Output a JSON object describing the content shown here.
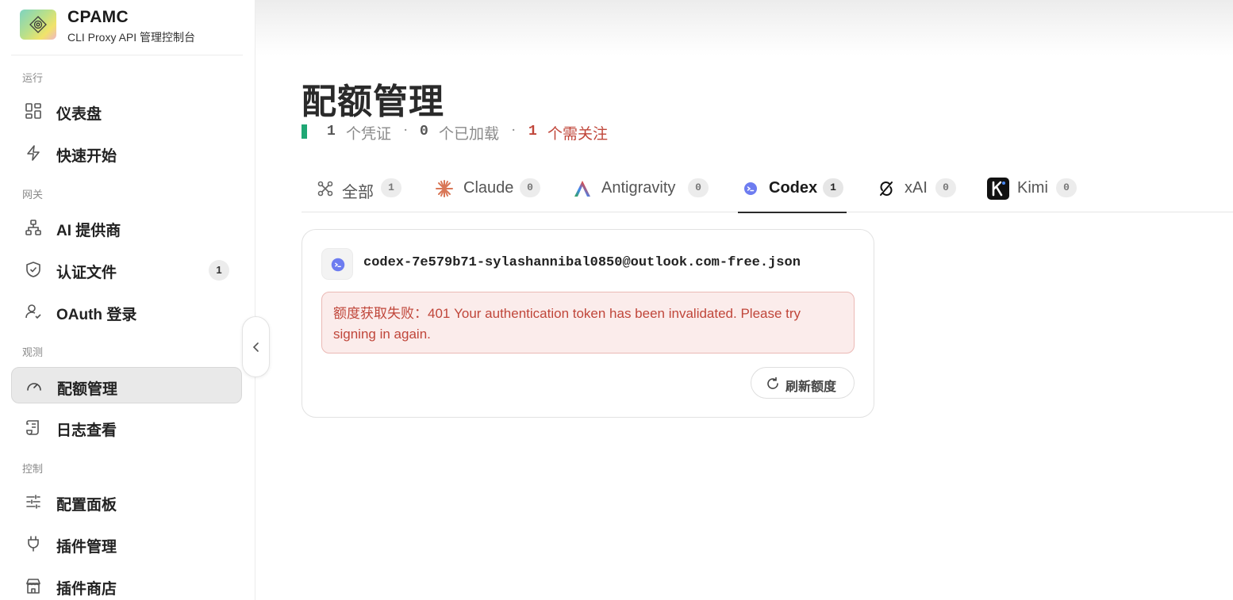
{
  "brand": {
    "name": "CPAMC",
    "subtitle": "CLI Proxy API 管理控制台"
  },
  "sidebar": {
    "sections": [
      "运行",
      "网关",
      "观测",
      "控制"
    ],
    "items": [
      {
        "label": "仪表盘",
        "icon": "dashboard-icon"
      },
      {
        "label": "快速开始",
        "icon": "lightning-icon"
      },
      {
        "label": "AI 提供商",
        "icon": "network-icon"
      },
      {
        "label": "认证文件",
        "icon": "shield-icon",
        "badge": "1"
      },
      {
        "label": "OAuth 登录",
        "icon": "user-icon"
      },
      {
        "label": "配额管理",
        "icon": "gauge-icon",
        "active": true
      },
      {
        "label": "日志查看",
        "icon": "scroll-icon"
      },
      {
        "label": "配置面板",
        "icon": "sliders-icon"
      },
      {
        "label": "插件管理",
        "icon": "plug-icon"
      },
      {
        "label": "插件商店",
        "icon": "store-icon"
      }
    ]
  },
  "page": {
    "title": "配额管理",
    "stats": {
      "credentials_count": "1",
      "credentials_label": "个凭证",
      "loaded_count": "0",
      "loaded_label": "个已加载",
      "attention_count": "1",
      "attention_label": "个需关注",
      "separator": "·"
    }
  },
  "tabs": [
    {
      "label": "全部",
      "count": "1",
      "icon": "all-icon"
    },
    {
      "label": "Claude",
      "count": "0",
      "icon": "claude-icon"
    },
    {
      "label": "Antigravity",
      "count": "0",
      "icon": "antigravity-icon"
    },
    {
      "label": "Codex",
      "count": "1",
      "icon": "codex-icon",
      "active": true
    },
    {
      "label": "xAI",
      "count": "0",
      "icon": "xai-icon"
    },
    {
      "label": "Kimi",
      "count": "0",
      "icon": "kimi-icon"
    }
  ],
  "card": {
    "file_name": "codex-7e579b71-sylashannibal0850@outlook.com-free.json",
    "error": "额度获取失败：401 Your authentication token has been invalidated. Please try signing in again.",
    "refresh_label": "刷新额度"
  },
  "colors": {
    "accent_green": "#1fa774",
    "error_red": "#c0463a",
    "error_bg": "#fbeceb"
  }
}
